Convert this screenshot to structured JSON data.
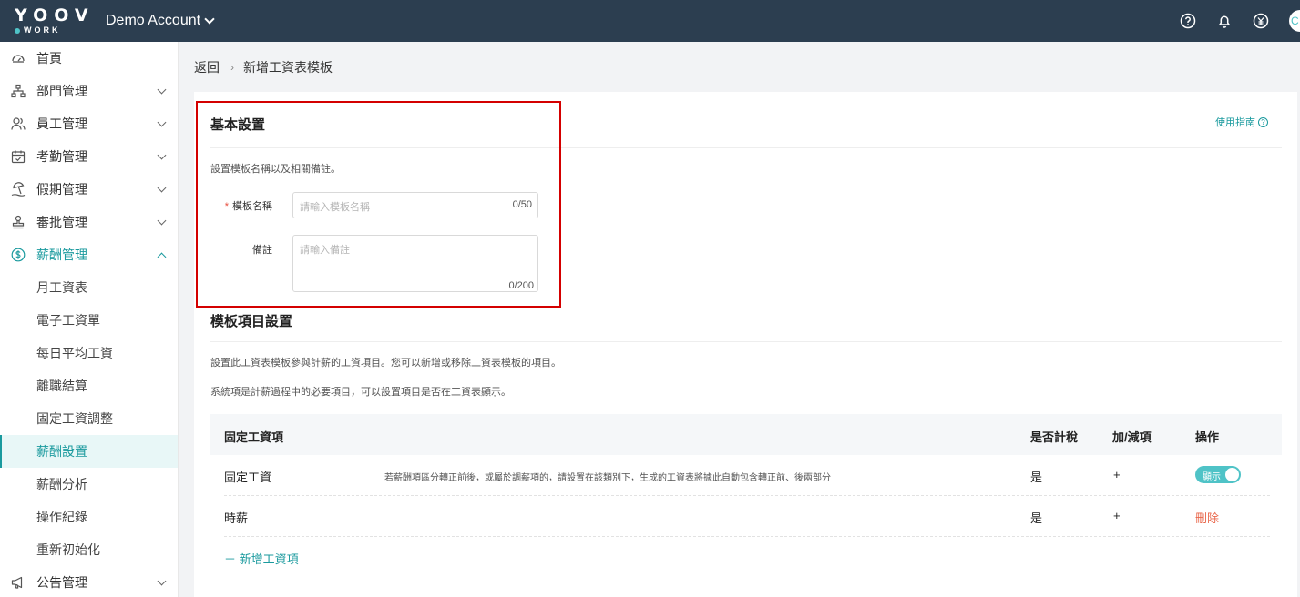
{
  "topbar": {
    "logo_top": "YOOV",
    "logo_bottom": "WORK",
    "account": "Demo Account",
    "icons": [
      "help-icon",
      "bell-icon",
      "currency-icon"
    ],
    "avatar_initial": "C"
  },
  "sidebar": {
    "items": [
      {
        "label": "首頁",
        "icon": "dashboard-icon"
      },
      {
        "label": "部門管理",
        "icon": "org-chart-icon"
      },
      {
        "label": "員工管理",
        "icon": "people-icon"
      },
      {
        "label": "考勤管理",
        "icon": "calendar-check-icon"
      },
      {
        "label": "假期管理",
        "icon": "beach-icon"
      },
      {
        "label": "審批管理",
        "icon": "stamp-icon"
      },
      {
        "label": "薪酬管理",
        "icon": "dollar-icon"
      }
    ],
    "subitems": [
      "月工資表",
      "電子工資單",
      "每日平均工資",
      "離職結算",
      "固定工資調整",
      "薪酬設置",
      "薪酬分析",
      "操作紀錄",
      "重新初始化"
    ],
    "bottom_item": {
      "label": "公告管理",
      "icon": "megaphone-icon"
    }
  },
  "breadcrumb": {
    "back": "返回",
    "sep": "›",
    "current": "新增工資表模板"
  },
  "basic": {
    "title": "基本設置",
    "guide": "使用指南",
    "hint": "設置模板名稱以及相關備註。",
    "name_label": "模板名稱",
    "name_required": "*",
    "name_placeholder": "請輸入模板名稱",
    "name_count": "0/50",
    "remark_label": "備註",
    "remark_placeholder": "請輸入備註",
    "remark_count": "0/200"
  },
  "items": {
    "title": "模板項目設置",
    "hint1": "設置此工資表模板參與計薪的工資項目。您可以新增或移除工資表模板的項目。",
    "hint2": "系統項是計薪過程中的必要項目，可以設置項目是否在工資表顯示。",
    "table": {
      "headers": [
        "固定工資項",
        "是否計稅",
        "加/減項",
        "操作"
      ],
      "rows": [
        {
          "name": "固定工資",
          "note": "若薪酬項區分轉正前後，或屬於調薪項的，請設置在該類別下，生成的工資表將據此自動包含轉正前、後兩部分",
          "taxable": "是",
          "sign": "+",
          "toggle": "顯示"
        },
        {
          "name": "時薪",
          "note": "",
          "taxable": "是",
          "sign": "+",
          "action": "刪除"
        }
      ]
    },
    "add_label": "＋ 新增工資項"
  }
}
